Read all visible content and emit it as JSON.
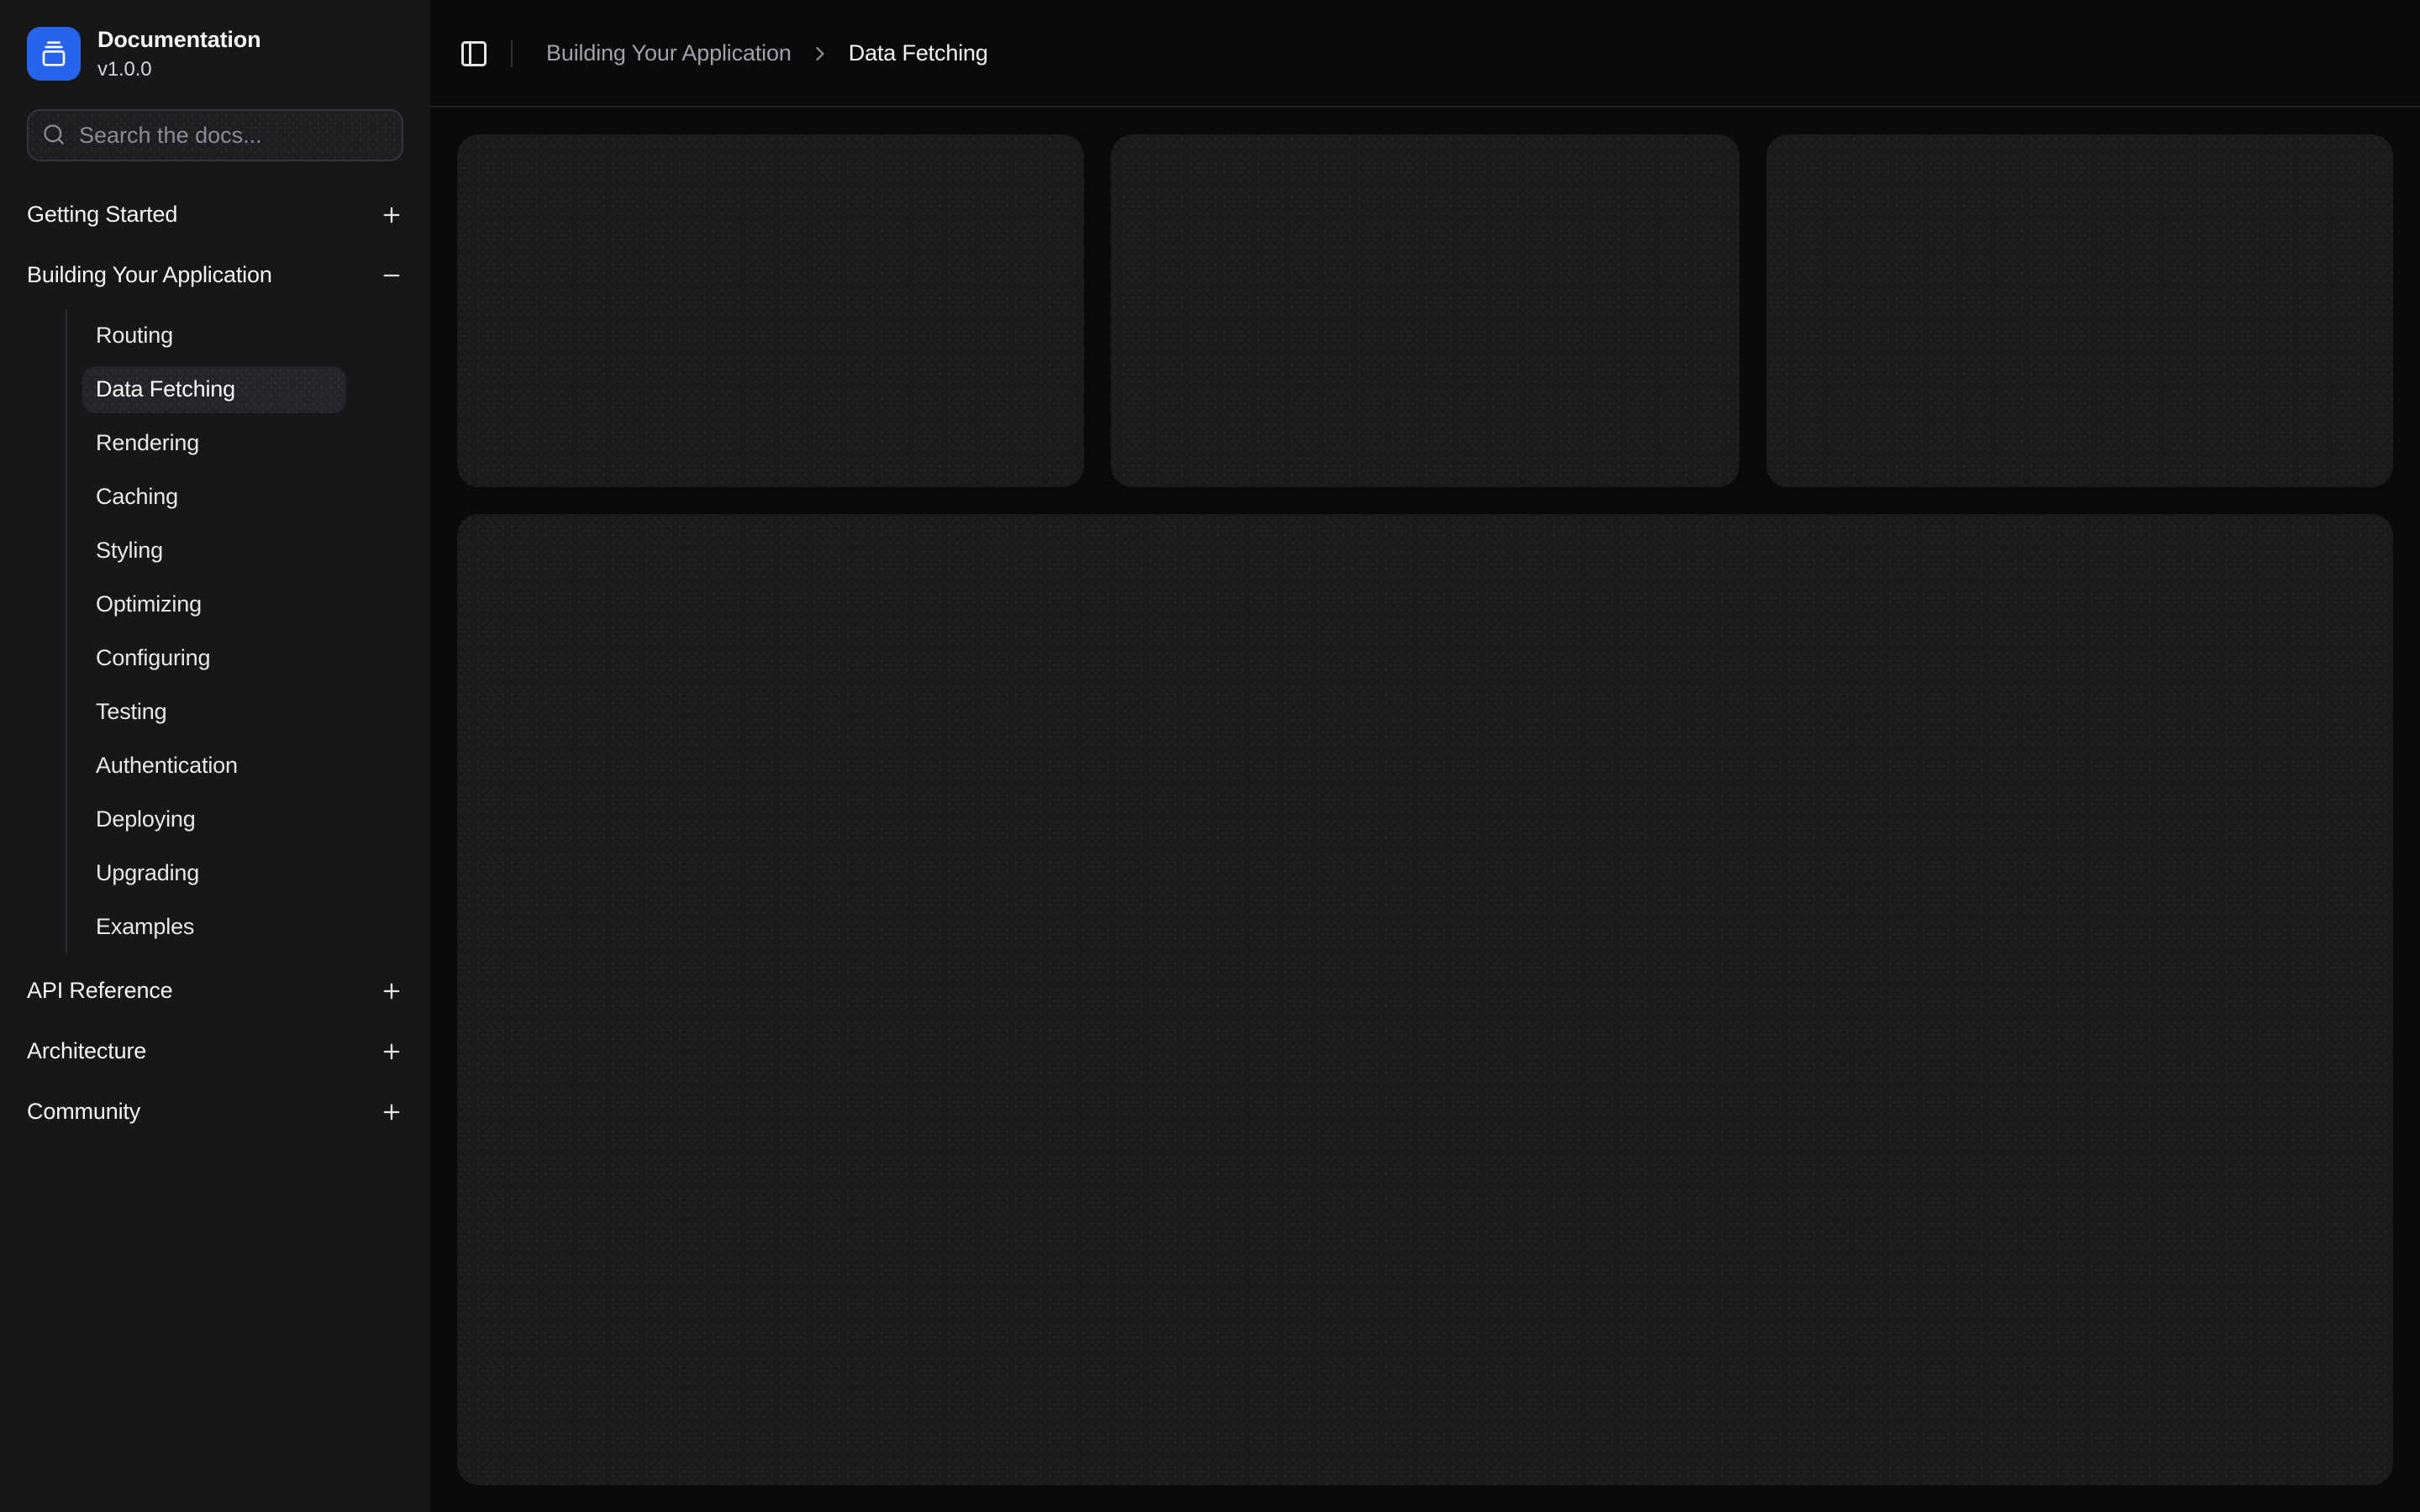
{
  "app": {
    "name": "Documentation",
    "version": "v1.0.0"
  },
  "search": {
    "placeholder": "Search the docs...",
    "icon": "search-icon"
  },
  "sidebar": {
    "sections": [
      {
        "label": "Getting Started",
        "expanded": false,
        "toggle_icon": "plus-icon"
      },
      {
        "label": "Building Your Application",
        "expanded": true,
        "toggle_icon": "minus-icon",
        "items": [
          {
            "label": "Routing",
            "active": false
          },
          {
            "label": "Data Fetching",
            "active": true
          },
          {
            "label": "Rendering",
            "active": false
          },
          {
            "label": "Caching",
            "active": false
          },
          {
            "label": "Styling",
            "active": false
          },
          {
            "label": "Optimizing",
            "active": false
          },
          {
            "label": "Configuring",
            "active": false
          },
          {
            "label": "Testing",
            "active": false
          },
          {
            "label": "Authentication",
            "active": false
          },
          {
            "label": "Deploying",
            "active": false
          },
          {
            "label": "Upgrading",
            "active": false
          },
          {
            "label": "Examples",
            "active": false
          }
        ]
      },
      {
        "label": "API Reference",
        "expanded": false,
        "toggle_icon": "plus-icon"
      },
      {
        "label": "Architecture",
        "expanded": false,
        "toggle_icon": "plus-icon"
      },
      {
        "label": "Community",
        "expanded": false,
        "toggle_icon": "plus-icon"
      }
    ]
  },
  "header": {
    "toggle_icon": "panel-left-icon",
    "separator_icon": "chevron-right-icon",
    "breadcrumb": [
      {
        "label": "Building Your Application",
        "current": false
      },
      {
        "label": "Data Fetching",
        "current": true
      }
    ]
  },
  "main": {
    "top_placeholder_cards": 3,
    "body_placeholder_cards": 1
  },
  "colors": {
    "accent": "#2563eb",
    "content_bg": "#0a0a0b",
    "sidebar_bg": "#171719",
    "card_bg": "#1a1a1c",
    "active_item_bg": "#242428",
    "input_bg": "#1e1e21",
    "border": "#222226",
    "text_primary": "#fafafa",
    "text_muted": "#a1a1aa"
  }
}
